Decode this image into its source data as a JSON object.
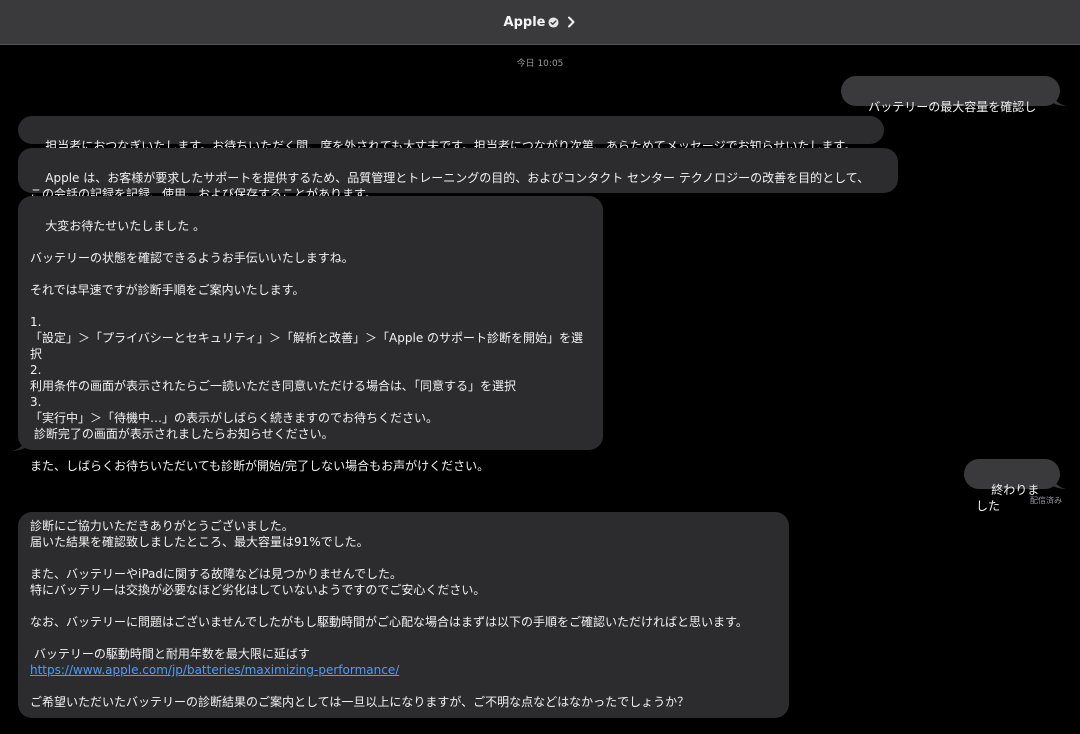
{
  "header": {
    "name": "Apple"
  },
  "timestamp": "今日 10:05",
  "messages": {
    "m1": "バッテリーの最大容量を確認したい",
    "m2": "担当者におつなぎいたします。お待ちいただく間、席を外されても大丈夫です。担当者につながり次第、あらためてメッセージでお知らせいたします。",
    "m3": "Apple は、お客様が要求したサポートを提供するため、品質管理とトレーニングの目的、およびコンタクト センター テクノロジーの改善を目的として、\nこの会話の記録を記録、使用、および保存することがあります。",
    "m4": "大変お待たせいたしました 。\n\nバッテリーの状態を確認できるようお手伝いいたしますね。\n\nそれでは早速ですが診断手順をご案内いたします。\n\n1.\n「設定」＞「プライバシーとセキュリティ」＞「解析と改善」＞「Apple のサポート診断を開始」を選択\n2.\n利用条件の画面が表示されたらご一読いただき同意いただける場合は､「同意する」を選択\n3.\n「実行中」＞「待機中…」の表示がしばらく続きますのでお待ちください。\n 診断完了の画面が表示されましたらお知らせください。\n\nまた、しばらくお待ちいただいても診断が開始/完了しない場合もお声がけください。",
    "m5": "終わりました",
    "m6_part1": "診断にご協力いただきありがとうございました。\n届いた結果を確認致しましたところ、最大容量は91%でした。\n\nまた、バッテリーやiPadに関する故障などは見つかりませんでした。\n特にバッテリーは交換が必要なほど劣化はしていないようですのでご安心ください。\n\nなお、バッテリーに問題はございませんでしたがもし駆動時間がご心配な場合はまずは以下の手順をご確認いただければと思います。\n\n バッテリーの駆動時間と耐用年数を最大限に延ばす\n",
    "m6_link": "https://www.apple.com/jp/batteries/maximizing-performance/",
    "m6_part2": "\n\nご希望いただいたバッテリーの診断結果のご案内としては一旦以上になりますが、ご不明な点などはなかったでしょうか？"
  },
  "read_receipt": "配信済み",
  "colors": {
    "incoming_bubble": "#2c2c2e",
    "outgoing_bubble": "#3a3a3c",
    "header_bg": "#3a3a3c",
    "link": "#4a9dff"
  }
}
